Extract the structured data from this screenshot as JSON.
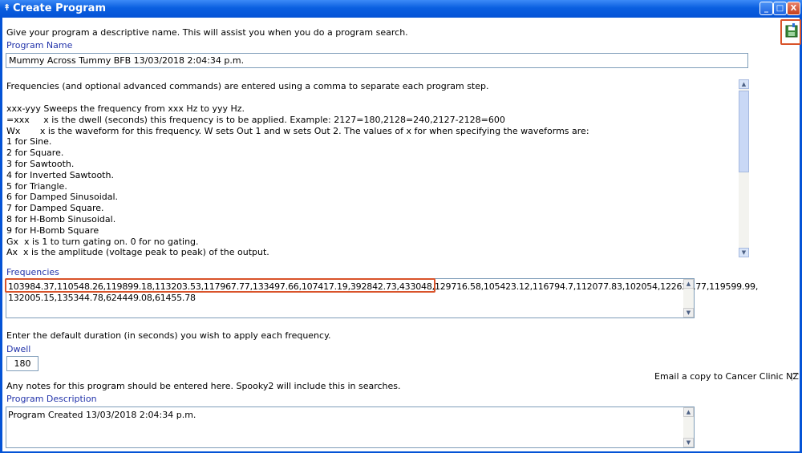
{
  "window": {
    "title": "Create Program",
    "buttons": {
      "minimize": "_",
      "maximize": "□",
      "close": "X"
    }
  },
  "program_name": {
    "intro": "Give your program a descriptive name. This will assist you when you do a program search.",
    "label": "Program Name",
    "value": "Mummy Across Tummy BFB 13/03/2018 2:04:34 p.m."
  },
  "help_text": {
    "intro": "Frequencies (and optional advanced commands) are entered using a comma to separate each program step.",
    "lines": [
      "xxx-yyy Sweeps the frequency from xxx Hz to yyy Hz.",
      "=xxx     x is the dwell (seconds) this frequency is to be applied. Example: 2127=180,2128=240,2127-2128=600",
      "Wx       x is the waveform for this frequency. W sets Out 1 and w sets Out 2. The values of x for when specifying the waveforms are:",
      "1 for Sine.",
      "2 for Square.",
      "3 for Sawtooth.",
      "4 for Inverted Sawtooth.",
      "5 for Triangle.",
      "6 for Damped Sinusoidal.",
      "7 for Damped Square.",
      "8 for H-Bomb Sinusoidal.",
      "9 for H-Bomb Square",
      "Gx  x is 1 to turn gating on. 0 for no gating.",
      "Ax  x is the amplitude (voltage peak to peak) of the output."
    ]
  },
  "frequencies": {
    "label": "Frequencies",
    "line1_highlighted": "103984.37,110548.26,119899.18,113203.53,117967.77,133497.66,107417.19,392842.73,433048,129716.58",
    "line1_rest": ",105423.12,116794.7,112077.83,102054,122625.77,119599.99,",
    "line2": "132005.15,135344.78,624449.08,61455.78"
  },
  "dwell": {
    "intro": "Enter the default duration (in seconds) you wish to apply each frequency.",
    "label": "Dwell",
    "value": "180"
  },
  "email": {
    "label": "Email a copy to Cancer Clinic NZ"
  },
  "description": {
    "intro": "Any notes for this program should be entered here. Spooky2 will include this in searches.",
    "label": "Program Description",
    "value": "Program Created 13/03/2018 2:04:34 p.m."
  },
  "icons": {
    "save": "save-icon",
    "scroll_up": "scroll-up-icon",
    "scroll_down": "scroll-down-icon"
  },
  "colors": {
    "titlebar": "#0453d6",
    "label": "#2233aa",
    "highlight": "#d9532a"
  }
}
